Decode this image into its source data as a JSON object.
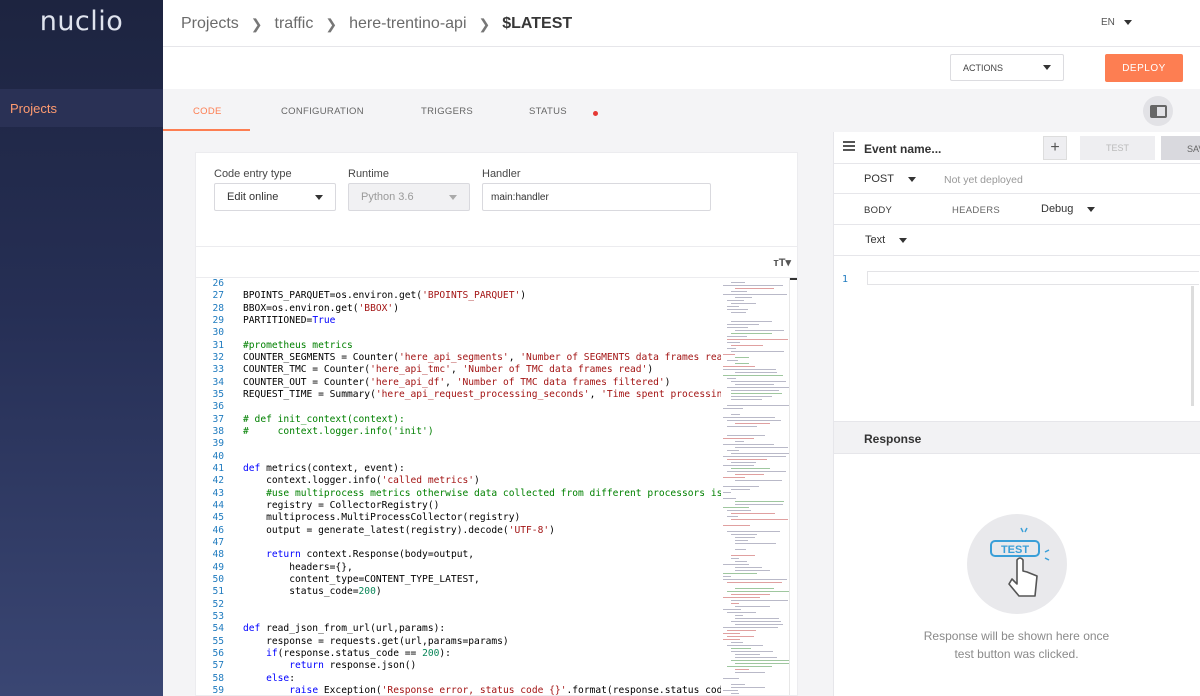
{
  "app": {
    "logo_text": "nuclio"
  },
  "sidebar": {
    "items": [
      {
        "label": "Projects"
      }
    ]
  },
  "header": {
    "breadcrumbs": [
      {
        "label": "Projects"
      },
      {
        "label": "traffic"
      },
      {
        "label": "here-trentino-api"
      },
      {
        "label": "$LATEST"
      }
    ],
    "language": "EN"
  },
  "toolbar": {
    "actions_label": "ACTIONS",
    "deploy_label": "DEPLOY"
  },
  "tabs": [
    {
      "label": "CODE",
      "active": true
    },
    {
      "label": "CONFIGURATION"
    },
    {
      "label": "TRIGGERS"
    },
    {
      "label": "STATUS",
      "indicator_color": "#e53935"
    }
  ],
  "code_settings": {
    "entry_type": {
      "label": "Code entry type",
      "value": "Edit online"
    },
    "runtime": {
      "label": "Runtime",
      "value": "Python 3.6"
    },
    "handler": {
      "label": "Handler",
      "value": "main:handler"
    }
  },
  "editor": {
    "font_size_icon": "text-size-icon",
    "lines": [
      {
        "n": "26",
        "t": []
      },
      {
        "n": "27",
        "t": [
          [
            "",
            "BPOINTS_PARQUET=os.environ.get("
          ],
          [
            "str",
            "'BPOINTS_PARQUET'"
          ],
          [
            "",
            ")"
          ]
        ]
      },
      {
        "n": "28",
        "t": [
          [
            "",
            "BBOX=os.environ.get("
          ],
          [
            "str",
            "'BBOX'"
          ],
          [
            "",
            ")"
          ]
        ]
      },
      {
        "n": "29",
        "t": [
          [
            "",
            "PARTITIONED="
          ],
          [
            "kw",
            "True"
          ]
        ]
      },
      {
        "n": "30",
        "t": []
      },
      {
        "n": "31",
        "t": [
          [
            "com",
            "#prometheus metrics"
          ]
        ]
      },
      {
        "n": "32",
        "t": [
          [
            "",
            "COUNTER_SEGMENTS = Counter("
          ],
          [
            "str",
            "'here_api_segments'"
          ],
          [
            "",
            ", "
          ],
          [
            "str",
            "'Number of SEGMENTS data frames read'"
          ],
          [
            "",
            ")"
          ]
        ]
      },
      {
        "n": "33",
        "t": [
          [
            "",
            "COUNTER_TMC = Counter("
          ],
          [
            "str",
            "'here_api_tmc'"
          ],
          [
            "",
            ", "
          ],
          [
            "str",
            "'Number of TMC data frames read'"
          ],
          [
            "",
            ")"
          ]
        ]
      },
      {
        "n": "34",
        "t": [
          [
            "",
            "COUNTER_OUT = Counter("
          ],
          [
            "str",
            "'here_api_df'"
          ],
          [
            "",
            ", "
          ],
          [
            "str",
            "'Number of TMC data frames filtered'"
          ],
          [
            "",
            ")"
          ]
        ]
      },
      {
        "n": "35",
        "t": [
          [
            "",
            "REQUEST_TIME = Summary("
          ],
          [
            "str",
            "'here_api_request_processing_seconds'"
          ],
          [
            "",
            ", "
          ],
          [
            "str",
            "'Time spent processing request'"
          ],
          [
            "",
            ")"
          ]
        ]
      },
      {
        "n": "36",
        "t": []
      },
      {
        "n": "37",
        "t": [
          [
            "com",
            "# def init_context(context):"
          ]
        ]
      },
      {
        "n": "38",
        "t": [
          [
            "com",
            "#     context.logger.info('init')"
          ]
        ]
      },
      {
        "n": "39",
        "t": []
      },
      {
        "n": "40",
        "t": []
      },
      {
        "n": "41",
        "t": [
          [
            "kw",
            "def"
          ],
          [
            "",
            " metrics(context, event):"
          ]
        ]
      },
      {
        "n": "42",
        "t": [
          [
            "",
            "    context.logger.info("
          ],
          [
            "str",
            "'called metrics'"
          ],
          [
            "",
            ")"
          ]
        ]
      },
      {
        "n": "43",
        "t": [
          [
            "com",
            "    #use multiprocess metrics otherwise data collected from different processors is not aggregated"
          ]
        ]
      },
      {
        "n": "44",
        "t": [
          [
            "",
            "    registry = CollectorRegistry()"
          ]
        ]
      },
      {
        "n": "45",
        "t": [
          [
            "",
            "    multiprocess.MultiProcessCollector(registry)"
          ]
        ]
      },
      {
        "n": "46",
        "t": [
          [
            "",
            "    output = generate_latest(registry).decode("
          ],
          [
            "str",
            "'UTF-8'"
          ],
          [
            "",
            ")"
          ]
        ]
      },
      {
        "n": "47",
        "t": []
      },
      {
        "n": "48",
        "t": [
          [
            "",
            "    "
          ],
          [
            "kw",
            "return"
          ],
          [
            "",
            " context.Response(body=output,"
          ]
        ]
      },
      {
        "n": "49",
        "t": [
          [
            "",
            "        headers={},"
          ]
        ]
      },
      {
        "n": "50",
        "t": [
          [
            "",
            "        content_type=CONTENT_TYPE_LATEST,"
          ]
        ]
      },
      {
        "n": "51",
        "t": [
          [
            "",
            "        status_code="
          ],
          [
            "num",
            "200"
          ],
          [
            "",
            ")"
          ]
        ]
      },
      {
        "n": "52",
        "t": []
      },
      {
        "n": "53",
        "t": []
      },
      {
        "n": "54",
        "t": [
          [
            "kw",
            "def"
          ],
          [
            "",
            " read_json_from_url(url,params):"
          ]
        ]
      },
      {
        "n": "55",
        "t": [
          [
            "",
            "    response = requests.get(url,params=params)"
          ]
        ]
      },
      {
        "n": "56",
        "t": [
          [
            "",
            "    "
          ],
          [
            "kw",
            "if"
          ],
          [
            "",
            "(response.status_code == "
          ],
          [
            "num",
            "200"
          ],
          [
            "",
            "):"
          ]
        ]
      },
      {
        "n": "57",
        "t": [
          [
            "",
            "        "
          ],
          [
            "kw",
            "return"
          ],
          [
            "",
            " response.json()"
          ]
        ]
      },
      {
        "n": "58",
        "t": [
          [
            "",
            "    "
          ],
          [
            "kw",
            "else"
          ],
          [
            "",
            ":"
          ]
        ]
      },
      {
        "n": "59",
        "t": [
          [
            "",
            "        "
          ],
          [
            "kw",
            "raise"
          ],
          [
            "",
            " Exception("
          ],
          [
            "str",
            "'Response error, status code {}'"
          ],
          [
            "",
            ".format(response.status_code))"
          ]
        ]
      }
    ]
  },
  "test_panel": {
    "menu_icon": "hamburger-icon",
    "event_name_placeholder": "Event name...",
    "add_label": "+",
    "test_label": "TEST",
    "save_label": "SAVE",
    "method": "POST",
    "deploy_status": "Not yet deployed",
    "body_tab": "BODY",
    "headers_tab": "HEADERS",
    "log_level": "Debug",
    "content_type": "Text",
    "body_line_number": "1",
    "response_title": "Response",
    "empty_icon_label": "TEST",
    "empty_message": "Response will be shown here once test button was clicked."
  },
  "colors": {
    "accent": "#fd7e52",
    "sidebar_bg": "#262f55",
    "link_blue": "#1f7bbf"
  }
}
